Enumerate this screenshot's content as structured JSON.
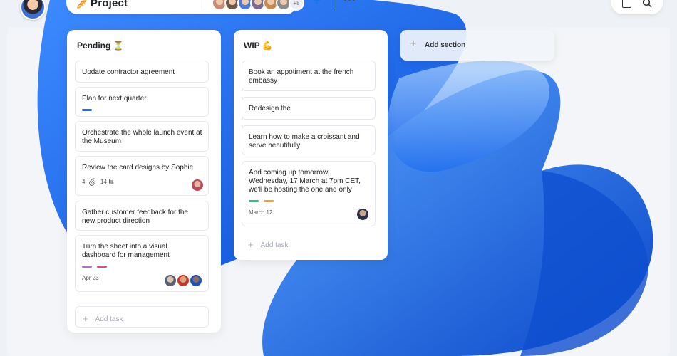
{
  "project": {
    "icon": "🥖",
    "title": "Project",
    "more_members": "+8",
    "members": [
      {
        "name": "member-1",
        "color": "#c98b7a"
      },
      {
        "name": "member-2",
        "color": "#6e5b4b"
      },
      {
        "name": "member-3",
        "color": "#4b7bd8"
      },
      {
        "name": "member-4",
        "color": "#7a6a96"
      },
      {
        "name": "member-5",
        "color": "#c28b52"
      },
      {
        "name": "member-6",
        "color": "#8c8c8c"
      }
    ],
    "add_label": "+",
    "more_label": "···"
  },
  "columns": [
    {
      "title": "Pending ⏳",
      "add_task": "Add task",
      "cards": [
        {
          "text": "Update contractor agreement"
        },
        {
          "text": "Plan for next quarter",
          "tags": [
            "#1a73e8"
          ]
        },
        {
          "text": "Orchestrate the whole launch event at the Museum"
        },
        {
          "text": "Review the card designs by Sophie",
          "attachments": "4",
          "subtasks": "14"
        },
        {
          "text": "Gather customer feedback for the new product direction"
        },
        {
          "text": "Turn the sheet into a visual dashboard for management",
          "tags": [
            "#b86ad8",
            "#e8467c"
          ],
          "date": "Apr 23"
        }
      ]
    },
    {
      "title": "WIP 💪",
      "add_task": "Add task",
      "cards": [
        {
          "text": "Book an appotiment at the french embassy"
        },
        {
          "text": "Redesign the"
        },
        {
          "text": "Learn how to make a croissant and serve beautifully"
        },
        {
          "text": "And coming up tomorrow, Wednesday, 17 March at 7pm CET, we'll be hosting the one and only",
          "tags": [
            "#2ec27e",
            "#f0a030"
          ],
          "date": "March 12"
        }
      ]
    }
  ],
  "add_section": "Add section",
  "icons": {
    "attachment": "paperclip-icon",
    "subtask": "subtask-icon",
    "search": "search-icon",
    "layout": "square-icon",
    "add": "plus-icon"
  }
}
